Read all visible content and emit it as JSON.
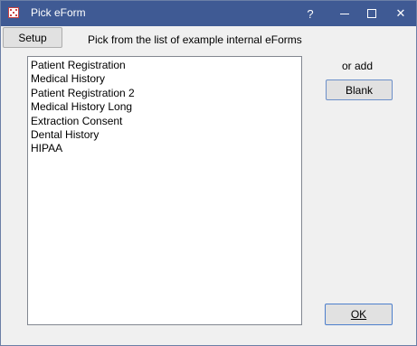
{
  "window": {
    "title": "Pick eForm",
    "help_label": "?",
    "close_label": "✕"
  },
  "toolbar": {
    "setup_label": "Setup",
    "instructions": "Pick from the list of example internal eForms"
  },
  "forms_list": {
    "items": [
      "Patient Registration",
      "Medical History",
      "Patient Registration 2",
      "Medical History Long",
      "Extraction Consent",
      "Dental History",
      "HIPAA"
    ]
  },
  "side": {
    "or_add_label": "or add",
    "blank_label": "Blank"
  },
  "footer": {
    "ok_label": "OK"
  },
  "colors": {
    "titlebar": "#3f5a94",
    "window_bg": "#f0f0f0"
  }
}
